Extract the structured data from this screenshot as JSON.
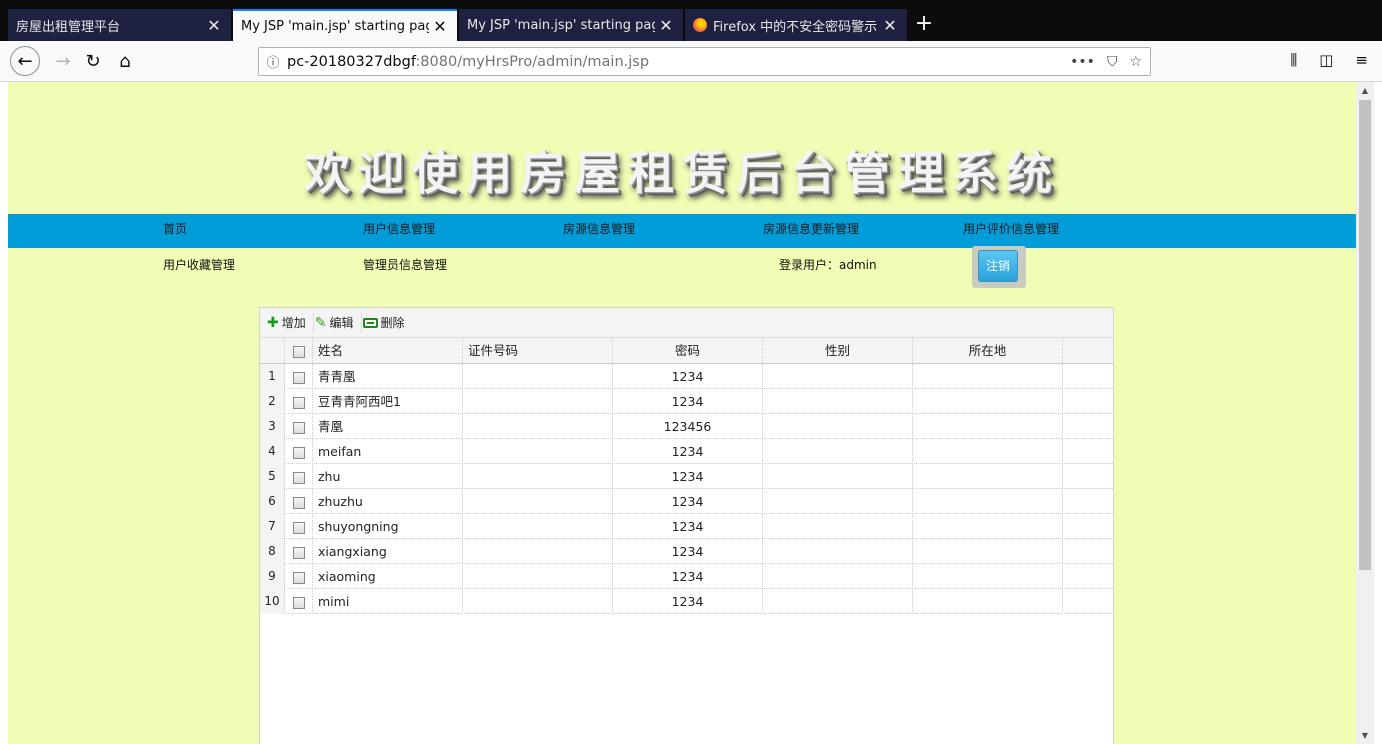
{
  "browser": {
    "tabs": [
      {
        "title": "房屋出租管理平台"
      },
      {
        "title": "My JSP 'main.jsp' starting page"
      },
      {
        "title": "My JSP 'main.jsp' starting page"
      },
      {
        "title": "Firefox 中的不安全密码警示 | "
      }
    ],
    "url_host": "pc-20180327dbgf",
    "url_rest": ":8080/myHrsPro/admin/main.jsp"
  },
  "page": {
    "banner": "欢迎使用房屋租赁后台管理系统",
    "menu": [
      "首页",
      "用户信息管理",
      "房源信息管理",
      "房源信息更新管理",
      "用户评价信息管理"
    ],
    "submenu": [
      "用户收藏管理",
      "管理员信息管理"
    ],
    "login_user": "登录用户：admin",
    "logout": "注销"
  },
  "grid": {
    "toolbar": {
      "add": "增加",
      "edit": "编辑",
      "delete": "删除"
    },
    "columns": {
      "name": "姓名",
      "id": "证件号码",
      "password": "密码",
      "gender": "性别",
      "location": "所在地"
    },
    "rows": [
      {
        "num": "1",
        "name": "青青凰",
        "id": "",
        "password": "1234",
        "gender": "",
        "location": ""
      },
      {
        "num": "2",
        "name": "豆青青阿西吧1",
        "id": "",
        "password": "1234",
        "gender": "",
        "location": ""
      },
      {
        "num": "3",
        "name": "青凰",
        "id": "",
        "password": "123456",
        "gender": "",
        "location": ""
      },
      {
        "num": "4",
        "name": "meifan",
        "id": "",
        "password": "1234",
        "gender": "",
        "location": ""
      },
      {
        "num": "5",
        "name": "zhu",
        "id": "",
        "password": "1234",
        "gender": "",
        "location": ""
      },
      {
        "num": "6",
        "name": "zhuzhu",
        "id": "",
        "password": "1234",
        "gender": "",
        "location": ""
      },
      {
        "num": "7",
        "name": "shuyongning",
        "id": "",
        "password": "1234",
        "gender": "",
        "location": ""
      },
      {
        "num": "8",
        "name": "xiangxiang",
        "id": "",
        "password": "1234",
        "gender": "",
        "location": ""
      },
      {
        "num": "9",
        "name": "xiaoming",
        "id": "",
        "password": "1234",
        "gender": "",
        "location": ""
      },
      {
        "num": "10",
        "name": "mimi",
        "id": "",
        "password": "1234",
        "gender": "",
        "location": ""
      }
    ]
  },
  "colors": {
    "page_bg": "#f0fdb5",
    "menu_bg": "#009dd9",
    "logout_bg": "#2aa3d9"
  }
}
